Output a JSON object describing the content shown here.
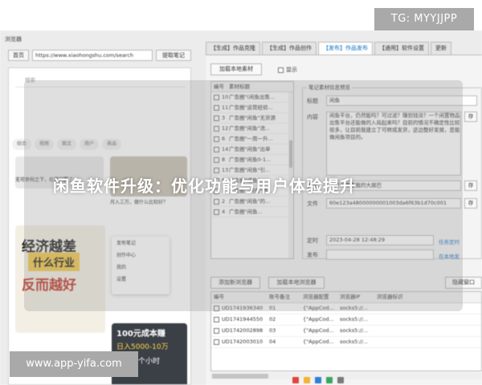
{
  "overlay": {
    "top_tag": "TG: MYYJJPP",
    "headline": "闲鱼软件升级：优化功能与用户体验提升",
    "bottom_url": "www.app-yifa.com"
  },
  "window": {
    "title": "浏览器"
  },
  "browser": {
    "home_label": "首页",
    "url": "https://www.xiaohongshu.com/search",
    "extract_label": "提取笔记",
    "search_placeholder": "搜索",
    "chips": [
      "综合",
      "视频",
      "图文",
      "用户",
      "商品"
    ],
    "card_caption_1": "无可奈何之下，在家闲置了",
    "card_caption_2": "月入三万，做什么比较好？",
    "poster_line1": "经济越差",
    "poster_line2": "什么行业",
    "poster_line3": "反而越好",
    "popup_items": [
      "发布笔记",
      "创作中心",
      "我的",
      "设置"
    ],
    "dark_card_line1": "100元成本赚",
    "dark_card_line2": "日入5000-10万",
    "dark_card_line3": "每天三个小时"
  },
  "tabs": [
    {
      "label": "【生成】作品克隆",
      "active": false
    },
    {
      "label": "【生成】作品创作",
      "active": false
    },
    {
      "label": "【发布】作品发布",
      "active": true
    },
    {
      "label": "【通用】软件设置",
      "active": false
    },
    {
      "label": "更新",
      "active": false
    }
  ],
  "toolbar": {
    "add_local_label": "加载本地素材",
    "show_label": "显示"
  },
  "material_list": {
    "col_no": "编号",
    "col_title": "素材标题",
    "rows": [
      {
        "no": "10",
        "title": "广告圈\"(闲鱼出售..."
      },
      {
        "no": "11",
        "title": "广告圈\"运营经验..."
      },
      {
        "no": "3",
        "title": "广告圈\"闲鱼\"无货源"
      },
      {
        "no": "12",
        "title": "广告圈\"闲鱼\"流..."
      },
      {
        "no": "6",
        "title": "广告圈\"一周一升..."
      },
      {
        "no": "14",
        "title": "广告圈\"闲鱼\"出单"
      },
      {
        "no": "8",
        "title": "广告圈\"闲鱼0-1..."
      },
      {
        "no": "13",
        "title": "广告圈\"闲鱼\"引..."
      },
      {
        "no": "9",
        "title": "广告圈\"咸鱼\"..."
      },
      {
        "no": "1",
        "title": "广告圈\"\"闲鱼\"周..."
      },
      {
        "no": "2",
        "title": "广告圈\"闲鱼\"的..."
      },
      {
        "no": "4",
        "title": "广告圈\"闲鱼..."
      }
    ]
  },
  "preview": {
    "caption": "笔记素材信息预览",
    "title_label": "标题",
    "title_value": "闲鱼",
    "content_label": "内容",
    "content_value": "闲鱼平台，仍然能吗？可过滤？赚到钱没？一个闲置物品出售平台还能做的入局起来吗？目前的情况不确定性比较很多，让目前我建立了可转成发货，这边整好发展，是能做闲鱼项目的。",
    "content_btn": "存",
    "select_label": "选择",
    "select_value": "点开头像看我的大展巴",
    "select_btn": "存",
    "file_label": "文件",
    "file_value": "60e123a48000000001003da6f63b1d70c001",
    "file_btn": "存",
    "schedule_label": "定时",
    "schedule_value": "2023-04-28 12:48:29",
    "schedule_link": "任务定时",
    "publish_label": "发布",
    "publish_link": "在本地发",
    "publish_value": ""
  },
  "browser_actions": {
    "add_browser_label": "添加新浏览器",
    "load_local_browser_label": "加载本地浏览器",
    "hide_label": "隐藏窗口"
  },
  "browser_table": {
    "headers": [
      "编号",
      "账号备注",
      "浏览器配置",
      "浏览器IP",
      "浏览器标识"
    ],
    "rows": [
      [
        "UD1741936340",
        "01",
        "{\"AppCod...",
        "socks5://...",
        ""
      ],
      [
        "UD1741944550",
        "02",
        "{\"AppCod...",
        "socks5://...",
        ""
      ],
      [
        "UD1742002898",
        "03",
        "{\"AppCod...",
        "socks5://...",
        ""
      ],
      [
        "UD1742003010",
        "04",
        "{\"AppCod...",
        "socks5://...",
        ""
      ]
    ]
  },
  "colors": {
    "accent": "#0a6fc2",
    "link": "#1a73c8",
    "watermark_bg": "#a9a9a9",
    "poster_highlight": "#f2c84b",
    "poster_red": "#c0392b"
  },
  "taskbar_icons": [
    "chrome-icon",
    "folder-icon",
    "app-icon",
    "mail-icon",
    "settings-icon"
  ]
}
